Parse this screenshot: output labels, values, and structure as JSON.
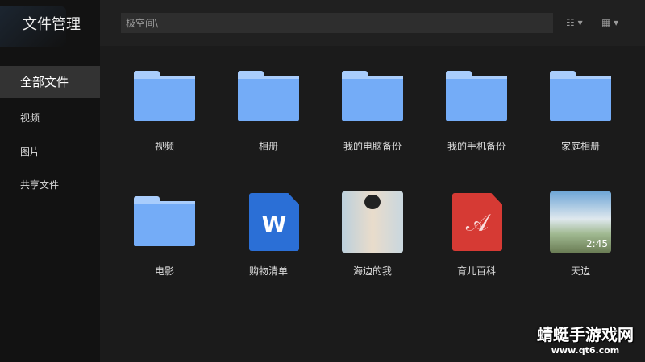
{
  "sidebar": {
    "title": "文件管理",
    "items": [
      {
        "label": "全部文件",
        "active": true
      },
      {
        "label": "视频"
      },
      {
        "label": "图片"
      },
      {
        "label": "共享文件"
      }
    ]
  },
  "header": {
    "path": "极空间\\",
    "sort_icon": "sort-icon",
    "view_icon": "grid-view-icon"
  },
  "files": [
    {
      "name": "视频",
      "type": "folder"
    },
    {
      "name": "相册",
      "type": "folder"
    },
    {
      "name": "我的电脑备份",
      "type": "folder"
    },
    {
      "name": "我的手机备份",
      "type": "folder"
    },
    {
      "name": "家庭相册",
      "type": "folder"
    },
    {
      "name": "电影",
      "type": "folder"
    },
    {
      "name": "购物清单",
      "type": "word",
      "glyph": "W"
    },
    {
      "name": "海边的我",
      "type": "image"
    },
    {
      "name": "育儿百科",
      "type": "pdf"
    },
    {
      "name": "天边",
      "type": "video",
      "duration": "2:45"
    }
  ],
  "colors": {
    "folder": "#74acf7",
    "word": "#2b6fd6",
    "pdf": "#d63a34"
  },
  "watermark": {
    "text": "蜻蜓手游戏网",
    "url": "www.qt6.com"
  }
}
